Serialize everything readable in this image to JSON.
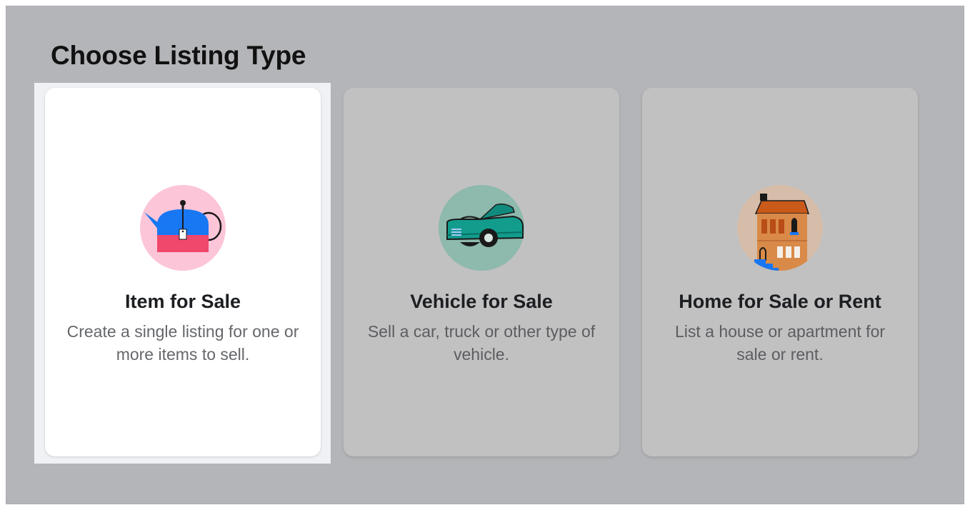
{
  "page": {
    "heading": "Choose Listing Type"
  },
  "cards": [
    {
      "title": "Item for Sale",
      "description": "Create a single listing for one or more items to sell.",
      "icon": "teapot-price-tag-icon",
      "selected": true
    },
    {
      "title": "Vehicle for Sale",
      "description": "Sell a car, truck or other type of vehicle.",
      "icon": "car-icon",
      "selected": false
    },
    {
      "title": "Home for Sale or Rent",
      "description": "List a house or apartment for sale or rent.",
      "icon": "house-icon",
      "selected": false
    }
  ],
  "colors": {
    "overlay": "#b4b5b8",
    "selected_card": "#ffffff",
    "dim_card": "#c1c1c2",
    "item_icon_bg": "#fdc5d8",
    "vehicle_icon_bg": "#8eb9ad",
    "home_icon_bg": "#d6bda9"
  }
}
